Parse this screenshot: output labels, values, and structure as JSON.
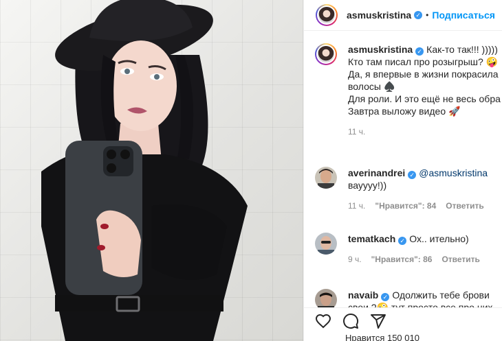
{
  "post": {
    "author": "asmuskristina",
    "follow_label": "Подписаться",
    "separator": "•"
  },
  "caption": {
    "username": "asmuskristina",
    "lines": [
      "Как-то так!!! )))))",
      "Кто там писал про розыгрыш? 🤪",
      "Да, я впервые в жизни покрасила",
      "волосы ♠️",
      "Для роли. И это ещё не весь обра",
      "Завтра выложу видео 🚀"
    ],
    "time": "11 ч."
  },
  "comments": [
    {
      "username": "averinandrei",
      "mention": "@asmuskristina",
      "line2": "вауууу!))",
      "time": "11 ч.",
      "likes": "\"Нравится\": 84",
      "reply_label": "Ответить"
    },
    {
      "username": "tematkach",
      "text": "Ох.. ительно)",
      "time": "9 ч.",
      "likes": "\"Нравится\": 86",
      "reply_label": "Ответить"
    },
    {
      "username": "navaib",
      "text": "Одолжить тебе брови",
      "line2": "свои ?🤪 тут просто все про них"
    }
  ],
  "likes_partial": "Нравится 150 010",
  "icons": {
    "like": "heart-icon",
    "comment": "comment-icon",
    "share": "paper-plane-icon",
    "verified": "verified-badge-icon"
  },
  "colors": {
    "accent": "#0095f6",
    "verified": "#3897f0",
    "muted": "#8e8e8e",
    "mention": "#00376b"
  }
}
